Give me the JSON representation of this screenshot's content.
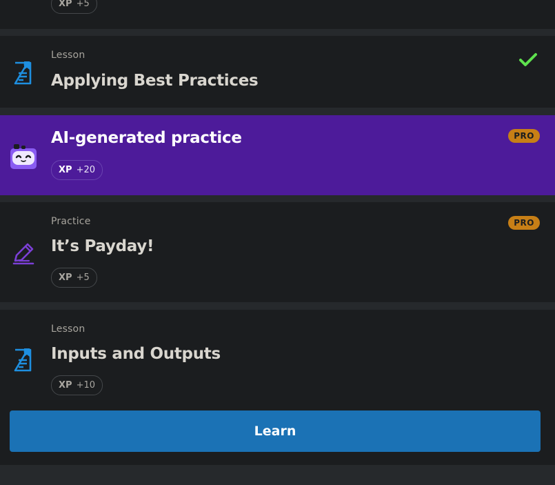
{
  "top_card": {
    "xp_label": "XP",
    "xp_value": "+5"
  },
  "items": [
    {
      "kind": "Lesson",
      "title": "Applying Best Practices",
      "completed": true
    },
    {
      "kind": "",
      "title": "AI-generated practice",
      "badge": "PRO",
      "xp_label": "XP",
      "xp_value": "+20"
    },
    {
      "kind": "Practice",
      "title": "It’s Payday!",
      "badge": "PRO",
      "xp_label": "XP",
      "xp_value": "+5"
    },
    {
      "kind": "Lesson",
      "title": "Inputs and Outputs",
      "xp_label": "XP",
      "xp_value": "+10"
    }
  ],
  "learn_button": {
    "label": "Learn"
  },
  "colors": {
    "page_bg": "#26292c",
    "card_bg": "#1b1d1f",
    "ai_card_bg": "#4d1b9a",
    "pro_badge": "#c77f16",
    "check": "#5ee14e",
    "lesson_icon": "#1e8fe0",
    "practice_icon": "#7b3fd6",
    "learn_button": "#1b72b5"
  }
}
